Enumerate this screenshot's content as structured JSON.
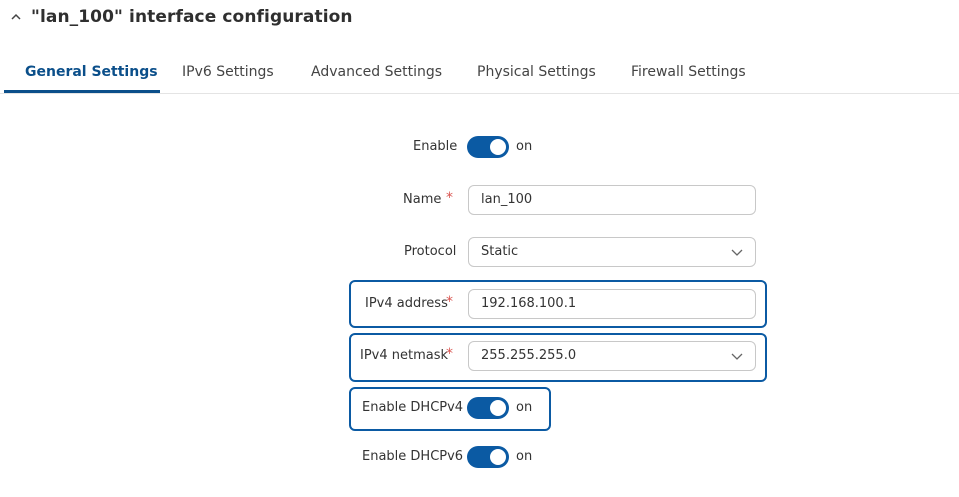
{
  "header": {
    "title": "\"lan_100\" interface configuration"
  },
  "tabs": [
    {
      "label": "General Settings"
    },
    {
      "label": "IPv6 Settings"
    },
    {
      "label": "Advanced Settings"
    },
    {
      "label": "Physical Settings"
    },
    {
      "label": "Firewall Settings"
    }
  ],
  "form": {
    "enable": {
      "label": "Enable",
      "state": "on"
    },
    "name": {
      "label": "Name",
      "value": "lan_100"
    },
    "protocol": {
      "label": "Protocol",
      "value": "Static"
    },
    "ipv4_address": {
      "label": "IPv4 address",
      "value": "192.168.100.1"
    },
    "ipv4_netmask": {
      "label": "IPv4 netmask",
      "value": "255.255.255.0"
    },
    "enable_dhcpv4": {
      "label": "Enable DHCPv4",
      "state": "on"
    },
    "enable_dhcpv6": {
      "label": "Enable DHCPv6",
      "state": "on"
    },
    "required_marker": "*"
  },
  "colors": {
    "accent": "#0b5aa3",
    "required": "#d9534f"
  }
}
